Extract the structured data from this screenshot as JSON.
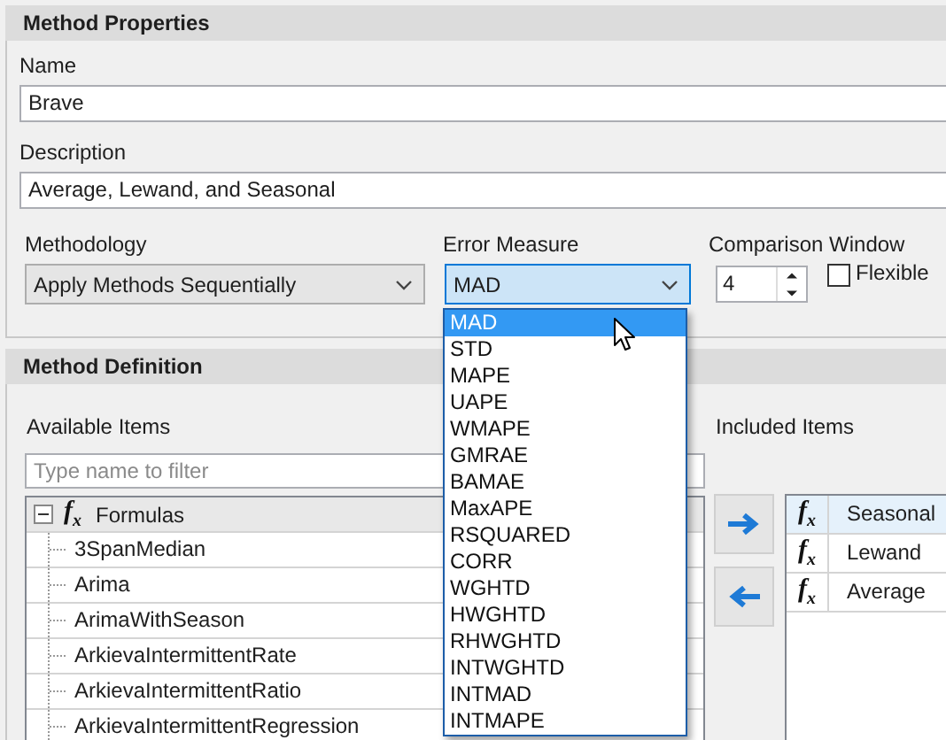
{
  "method_properties": {
    "title": "Method Properties",
    "name": {
      "label": "Name",
      "value": "Brave"
    },
    "description": {
      "label": "Description",
      "value": "Average, Lewand, and Seasonal"
    },
    "methodology": {
      "label": "Methodology",
      "value": "Apply Methods Sequentially"
    },
    "error_measure": {
      "label": "Error Measure",
      "value": "MAD",
      "open": true,
      "options": [
        {
          "label": "MAD",
          "selected": true
        },
        {
          "label": "STD",
          "selected": false
        },
        {
          "label": "MAPE",
          "selected": false
        },
        {
          "label": "UAPE",
          "selected": false
        },
        {
          "label": "WMAPE",
          "selected": false
        },
        {
          "label": "GMRAE",
          "selected": false
        },
        {
          "label": "BAMAE",
          "selected": false
        },
        {
          "label": "MaxAPE",
          "selected": false
        },
        {
          "label": "RSQUARED",
          "selected": false
        },
        {
          "label": "CORR",
          "selected": false
        },
        {
          "label": "WGHTD",
          "selected": false
        },
        {
          "label": "HWGHTD",
          "selected": false
        },
        {
          "label": "RHWGHTD",
          "selected": false
        },
        {
          "label": "INTWGHTD",
          "selected": false
        },
        {
          "label": "INTMAD",
          "selected": false
        },
        {
          "label": "INTMAPE",
          "selected": false
        }
      ]
    },
    "comparison_window": {
      "label": "Comparison Window",
      "value": "4"
    },
    "flexible": {
      "label": "Flexible",
      "checked": false
    }
  },
  "method_definition": {
    "title": "Method Definition",
    "available_items": {
      "label": "Available Items",
      "filter_placeholder": "Type name to filter",
      "tree": [
        {
          "label": "Formulas",
          "icon": "f$_{x}$",
          "expanded": true,
          "children": [
            {
              "label": "3SpanMedian"
            },
            {
              "label": "Arima"
            },
            {
              "label": "ArimaWithSeason"
            },
            {
              "label": "ArkievaIntermittentRate"
            },
            {
              "label": "ArkievaIntermittentRatio"
            },
            {
              "label": "ArkievaIntermittentRegression"
            }
          ]
        }
      ]
    },
    "included_items": {
      "label": "Included Items",
      "rows": [
        {
          "icon": "f$_{x}$",
          "label": "Seasonal",
          "selected": true
        },
        {
          "icon": "f$_{x}$",
          "label": "Lewand",
          "selected": false
        },
        {
          "icon": "f$_{x}$",
          "label": "Average",
          "selected": false
        }
      ]
    }
  }
}
